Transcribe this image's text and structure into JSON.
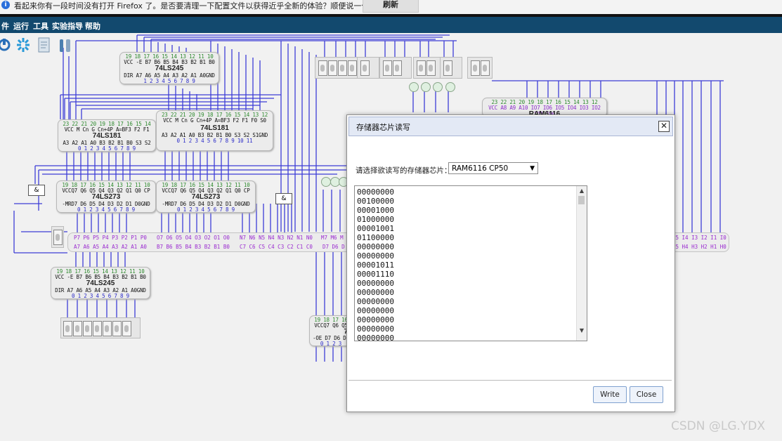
{
  "notification": {
    "message": "看起来你有一段时间没有打开 Firefox 了。是否要清理一下配置文件以获得近乎全新的体验？顺便说一句，欢迎回来！",
    "button": "刷新 Firefox..."
  },
  "menu": [
    "件",
    "运行",
    "工具",
    "实验指导",
    "帮助"
  ],
  "toolbar_icons": [
    "power-icon",
    "settings-gear-icon",
    "document-icon",
    "tools-icon"
  ],
  "chips": {
    "ls245_top": {
      "pins_top": "19 18 17 16 15 14 13 12 11 10",
      "sig_top": "VCC -E B7 B6 B5 B4 B3 B2 B1 B0",
      "name": "74LS245",
      "sig_bottom": "DIR A7 A6 A5 A4 A3 A2 A1 A0GND",
      "pins_bottom": "1  2  3  4  5  6  7  8  9"
    },
    "ls181_left": {
      "pins_top": "23 22 21 20 19 18 17 16 15 14",
      "sig_top": "VCC M  Cn  G Cn+4P A=BF3 F2 F1",
      "name": "74LS181",
      "sig_bottom": "A3 A2 A1 A0 B3 B2 B1 B0 S3 S2",
      "pins_bottom": "0  1  2  3  4  5  6  7  8  9"
    },
    "ls181_right": {
      "pins_top": "23 22 21 20 19 18 17 16 15 14 13 12",
      "sig_top": "VCC M  Cn  G Cn+4P A=BF3 F2 F1 F0 S0",
      "name": "74LS181",
      "sig_bottom": "A3 A2 A1 A0 B3 B2 B1 B0 S3 S2 S1GND",
      "pins_bottom": "0  1  2  3  4  5  6  7  8  9 10 11"
    },
    "ls273_left": {
      "pins_top": "19 18 17 16 15 14 13 12 11 10",
      "sig_top": "VCCQ7 Q6 Q5 Q4 Q3 Q2 Q1 Q0 CP",
      "name": "74LS273",
      "sig_bottom": "-MRD7 D6 D5 D4 D3 D2 D1 D0GND",
      "pins_bottom": "0  1  2  3  4  5  6  7  8  9"
    },
    "ls273_right": {
      "pins_top": "19 18 17 16 15 14 13 12 11 10",
      "sig_top": "VCCQ7 Q6 Q5 Q4 Q3 Q2 Q1 Q0 CP",
      "name": "74LS273",
      "sig_bottom": "-MRD7 D6 D5 D4 D3 D2 D1 D0GND",
      "pins_bottom": "0  1  2  3  4  5  6  7  8  9"
    },
    "ls245_bottom": {
      "pins_top": "19 18 17 16 15 14 13 12 11 10",
      "sig_top": "VCC -E B7 B6 B5 B4 B3 B2 B1 B0",
      "name": "74LS245",
      "sig_bottom": "DIR A7 A6 A5 A4 A3 A2 A1 A0GND",
      "pins_bottom": "0  1  2  3  4  5  6  7  8  9"
    },
    "ram6116": {
      "pins_top": "23 22 21 20 19 18 17 16 15 14 13 12",
      "sig_top": "VCC A8  A9 A10 IO7 IO6 IO5 IO4 IO3 IO2 IO1 IO0",
      "name": "RAM6116"
    },
    "partial_273": {
      "pins_top": "19 18 17 16",
      "sig_top": "VCCQ7 Q6 Q5",
      "name": "7",
      "sig_bottom": "-OE D7 D6 D5",
      "pins_bottom": "0  1  2  3"
    }
  },
  "bus": {
    "p_top": "P7  P6  P5  P4  P3  P2  P1  P0",
    "o_top": "O7  O6  O5  O4  O3  O2  O1  O0",
    "n_top": "N7  N6  N5  N4  N3  N2  N1  N0",
    "m_top": "M7 M6 M",
    "a_bottom": "A7  A6  A5  A4  A3  A2  A1  A0",
    "b_bottom": "B7  B6  B5  B4  B3  B2  B1  B0",
    "c_bottom": "C7  C6  C5  C4  C3  C2  C1  C0",
    "d_bottom": "D7  D6  D",
    "h_bottom": "H5  H4  H3  H2  H1  H0",
    "i_top": "I5  I4  I3  I2  I1  I0"
  },
  "and_gate": "&",
  "watermark": "CSDN @LG.YDX",
  "dialog": {
    "title": "存储器芯片读写",
    "prompt": "请选择欲读写的存储器芯片：",
    "selected_chip": "RAM6116 CP50",
    "memory_values": [
      "00000000",
      "00100000",
      "00001000",
      "01000000",
      "00001001",
      "01100000",
      "00000000",
      "00000000",
      "00001011",
      "00001110",
      "00000000",
      "00000000",
      "00000000",
      "00000000",
      "00000000",
      "00000000",
      "00000000"
    ],
    "buttons": {
      "write": "Write",
      "close": "Close"
    }
  }
}
